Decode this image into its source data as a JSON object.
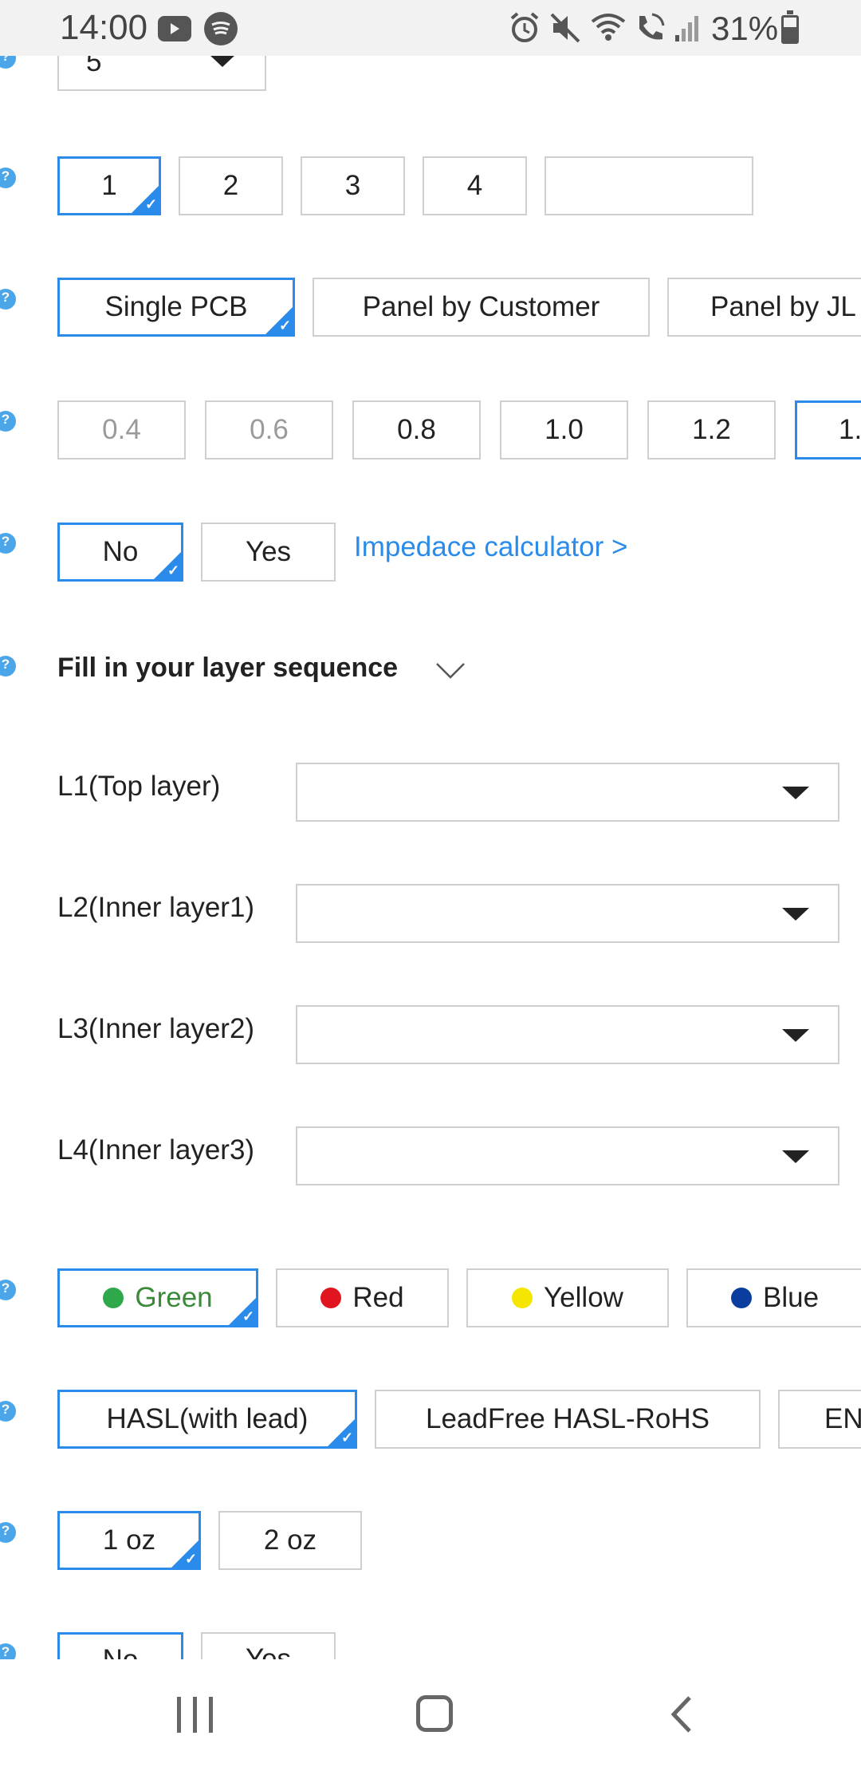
{
  "status_bar": {
    "time": "14:00",
    "battery": "31%",
    "icons": [
      "youtube-icon",
      "spotify-icon",
      "alarm-icon",
      "mute-icon",
      "wifi-icon",
      "wifi-call-icon",
      "signal-icon",
      "battery-icon"
    ]
  },
  "top_select": {
    "value": "5"
  },
  "layers_row": {
    "options": [
      "1",
      "2",
      "3",
      "4"
    ],
    "selected": "1",
    "custom_value": ""
  },
  "panel_row": {
    "options": [
      "Single PCB",
      "Panel by Customer",
      "Panel by JL"
    ],
    "selected": "Single PCB"
  },
  "thickness_row": {
    "options": [
      "0.4",
      "0.6",
      "0.8",
      "1.0",
      "1.2",
      "1."
    ],
    "disabled": [
      "0.4",
      "0.6"
    ],
    "selected": "1."
  },
  "impedance_row": {
    "options": [
      "No",
      "Yes"
    ],
    "selected": "No",
    "link": "Impedace calculator >"
  },
  "layer_sequence": {
    "title": "Fill in your layer sequence",
    "layers": [
      {
        "label": "L1(Top layer)",
        "value": ""
      },
      {
        "label": "L2(Inner layer1)",
        "value": ""
      },
      {
        "label": "L3(Inner layer2)",
        "value": ""
      },
      {
        "label": "L4(Inner layer3)",
        "value": ""
      }
    ]
  },
  "color_row": {
    "options": [
      {
        "label": "Green",
        "color": "#2ea84a"
      },
      {
        "label": "Red",
        "color": "#e0151f"
      },
      {
        "label": "Yellow",
        "color": "#f5e600"
      },
      {
        "label": "Blue",
        "color": "#0a3d9e"
      }
    ],
    "selected": "Green",
    "selected_text_color": "#3a8a3a"
  },
  "finish_row": {
    "options": [
      "HASL(with lead)",
      "LeadFree HASL-RoHS",
      "EN"
    ],
    "selected": "HASL(with lead)"
  },
  "copper_row": {
    "options": [
      "1 oz",
      "2 oz"
    ],
    "selected": "1 oz"
  },
  "last_row": {
    "options": [
      "No",
      "Yes"
    ],
    "selected": "No"
  },
  "accent_color": "#2a8bea"
}
